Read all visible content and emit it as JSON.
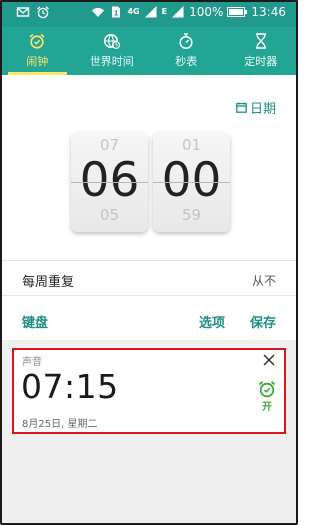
{
  "status": {
    "battery": "100%",
    "time": "13:46",
    "network": "4G",
    "network2": "E"
  },
  "tabs": [
    {
      "label": "闹钟",
      "icon": "alarm-icon",
      "active": true
    },
    {
      "label": "世界时间",
      "icon": "globe-clock-icon",
      "active": false
    },
    {
      "label": "秒表",
      "icon": "stopwatch-icon",
      "active": false
    },
    {
      "label": "定时器",
      "icon": "hourglass-icon",
      "active": false
    }
  ],
  "editor": {
    "date_link": "日期",
    "hour": {
      "prev": "07",
      "current": "06",
      "next": "05"
    },
    "minute": {
      "prev": "01",
      "current": "00",
      "next": "59"
    },
    "repeat_label": "每周重复",
    "repeat_value": "从不",
    "keyboard": "键盘",
    "options": "选项",
    "save": "保存"
  },
  "alarm": {
    "sound_label": "声音",
    "time": "07:15",
    "date": "8月25日, 星期二",
    "toggle_label": "开"
  },
  "colors": {
    "status_bar": "#1f9a8c",
    "tab_bar": "#23a596",
    "tab_indicator": "#ffe66a",
    "accent": "#1e8f80",
    "alarm_on": "#39a937",
    "highlight_border": "#e2141b"
  }
}
